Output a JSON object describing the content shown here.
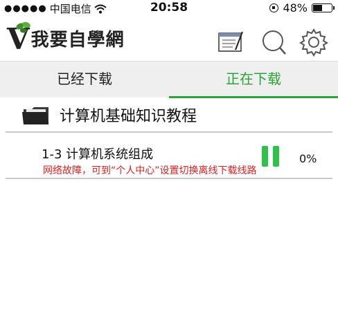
{
  "status_bar": {
    "carrier": "中国电信",
    "time": "20:58",
    "battery": "48%"
  },
  "header": {
    "logo_text": "我要自學網",
    "logo_letter": "V",
    "icons": [
      "list-icon",
      "search-icon",
      "gear-icon"
    ]
  },
  "tabs": [
    {
      "label": "已经下载",
      "active": false
    },
    {
      "label": "正在下载",
      "active": true
    }
  ],
  "course": {
    "title": "计算机基础知识教程"
  },
  "download": {
    "name": "1-3 计算机系统组成",
    "progress_text": "0%",
    "progress": 0,
    "error": "网络故障，可到“个人中心”设置切换离线下载线路"
  },
  "colors": {
    "accent": "#2aa43a",
    "error": "#e02020",
    "pause": "#2ec24a"
  }
}
